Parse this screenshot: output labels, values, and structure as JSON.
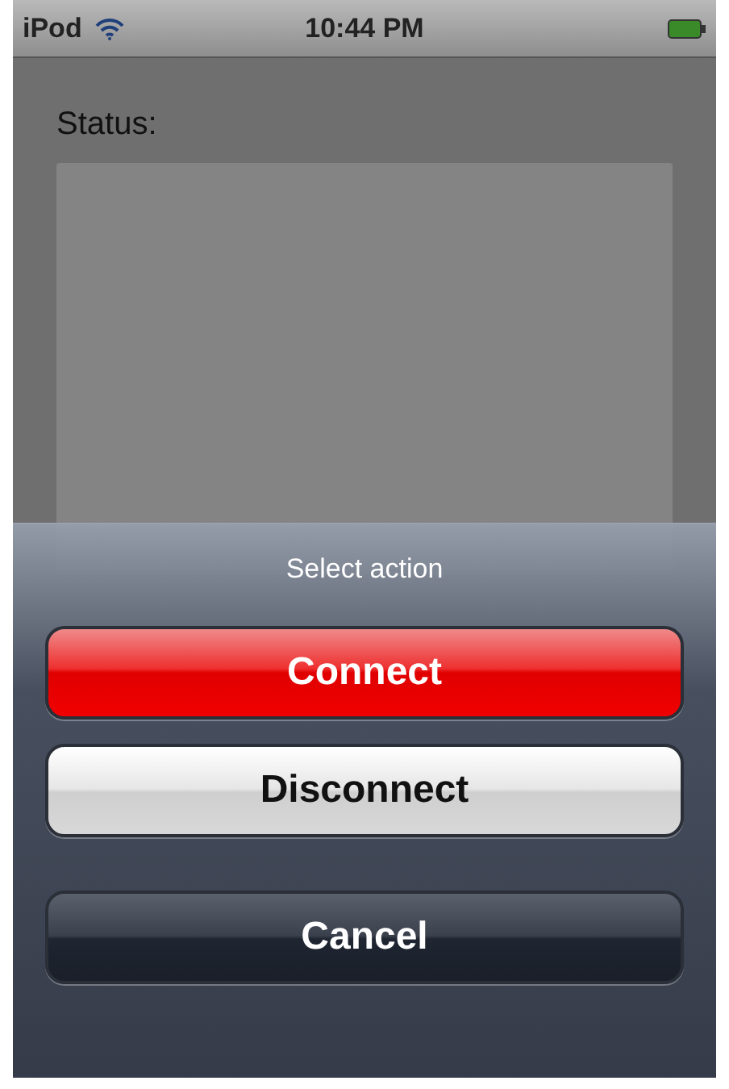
{
  "status_bar": {
    "carrier": "iPod",
    "time": "10:44 PM"
  },
  "status_label": "Status:",
  "action_sheet": {
    "title": "Select action",
    "buttons": [
      {
        "label": "Connect",
        "kind": "destructive"
      },
      {
        "label": "Disconnect",
        "kind": "default"
      },
      {
        "label": "Cancel",
        "kind": "cancel"
      }
    ]
  }
}
